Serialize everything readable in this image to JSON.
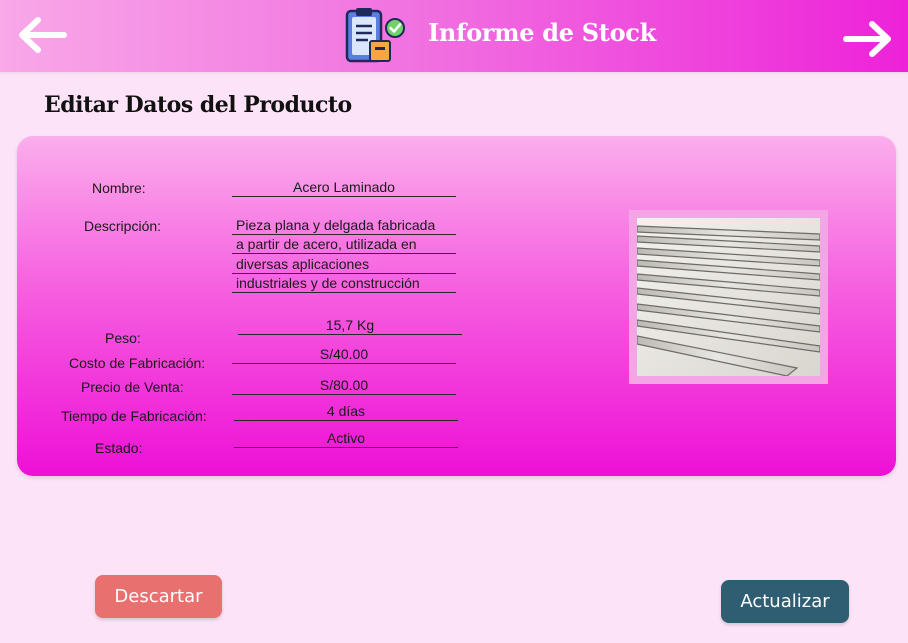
{
  "header": {
    "title": "Informe de Stock",
    "back_icon": "arrow-left-icon",
    "forward_icon": "arrow-right-icon",
    "brand_icon": "clipboard-check-icon"
  },
  "page": {
    "title": "Editar Datos del Producto"
  },
  "product": {
    "name_label": "Nombre:",
    "name": "Acero Laminado",
    "description_label": "Descripción:",
    "description_lines": [
      "Pieza plana y delgada fabricada",
      "a partir de acero, utilizada en",
      "diversas aplicaciones",
      "industriales y de construcción"
    ],
    "weight_label": "Peso:",
    "weight": "15,7 Kg",
    "cost_label": "Costo de Fabricación:",
    "cost": "S/40.00",
    "price_label": "Precio de Venta:",
    "price": "S/80.00",
    "time_label": "Tiempo de Fabricación:",
    "time": "4 días",
    "status_label": "Estado:",
    "status": "Activo"
  },
  "actions": {
    "discard_label": "Descartar",
    "update_label": "Actualizar"
  },
  "colors": {
    "header_gradient_end": "#ee22d9",
    "card_gradient_end": "#ee10d6",
    "discard": "#e8706e",
    "update": "#2f5e72",
    "background": "#fde3f7"
  }
}
